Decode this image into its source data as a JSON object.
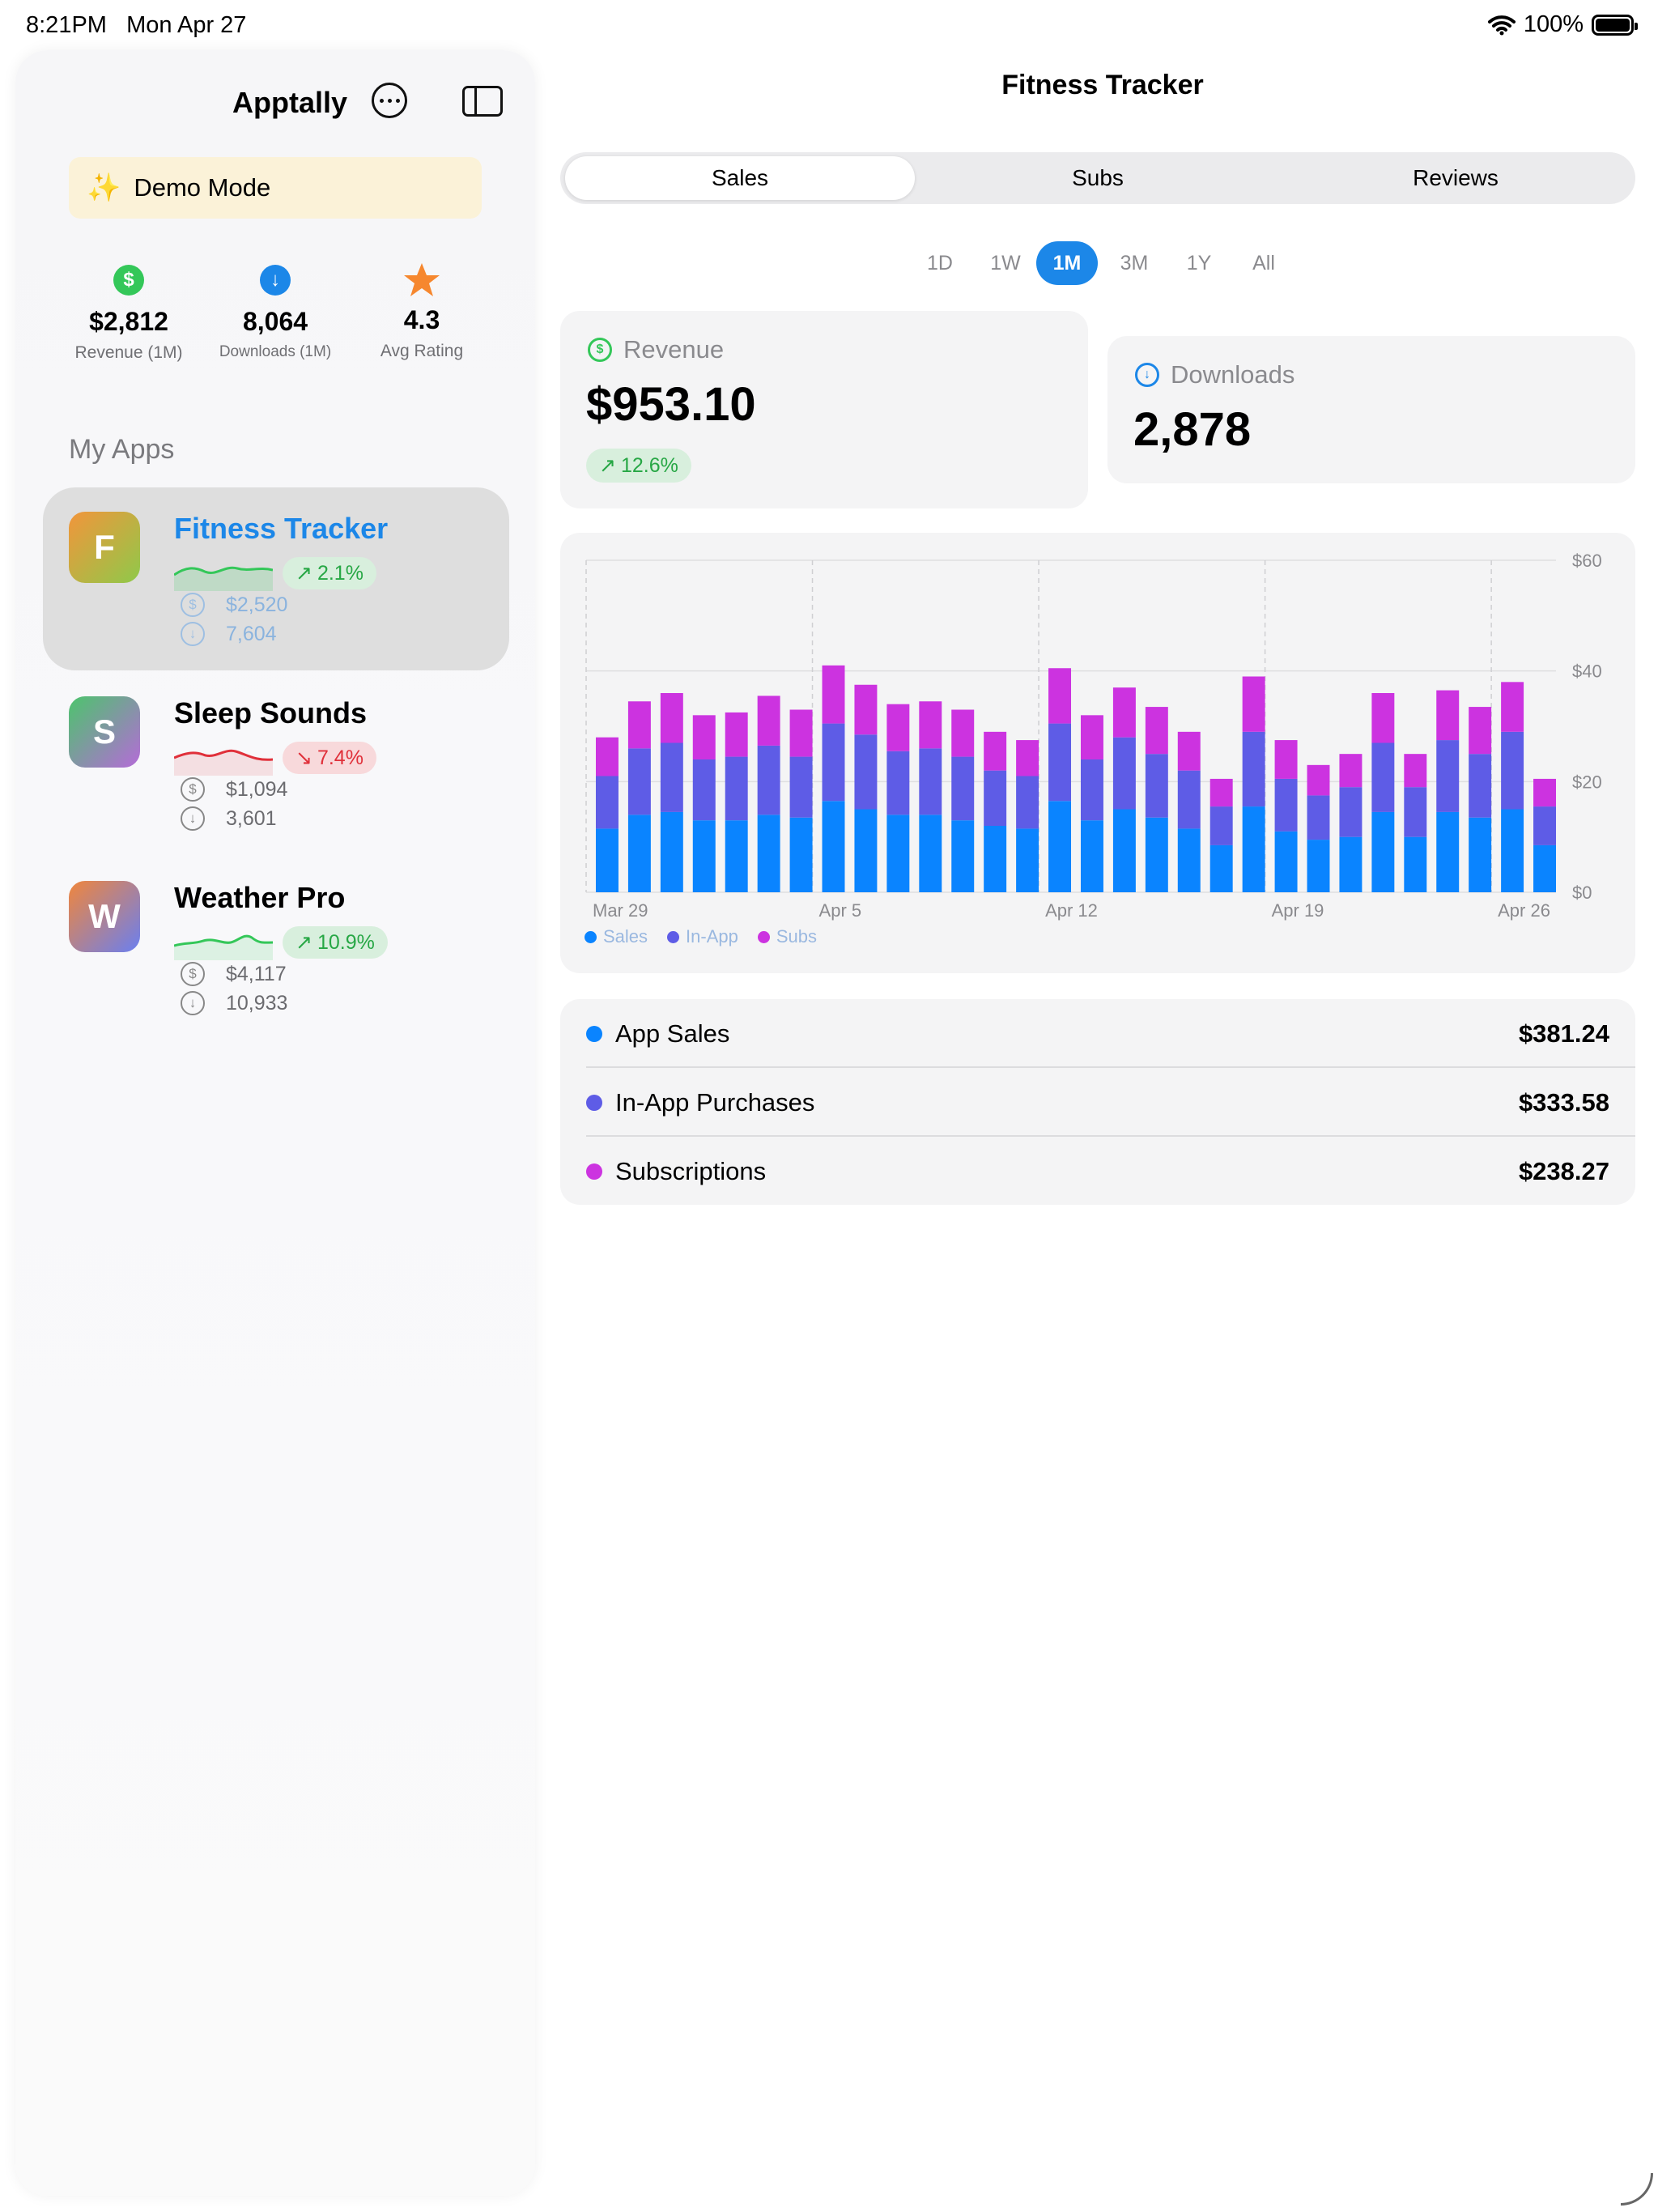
{
  "status_bar": {
    "time": "8:21PM",
    "date": "Mon Apr 27",
    "battery": "100%"
  },
  "sidebar": {
    "title": "Apptally",
    "demo_mode": "Demo Mode",
    "summary": [
      {
        "icon": "dollar-icon",
        "value": "$2,812",
        "label": "Revenue (1M)",
        "color": "#34c759"
      },
      {
        "icon": "download-icon",
        "value": "8,064",
        "label": "Downloads (1M)",
        "color": "#1c87e8"
      },
      {
        "icon": "star-icon",
        "value": "4.3",
        "label": "Avg Rating",
        "color": "#f6872e"
      }
    ],
    "section_title": "My Apps",
    "apps": [
      {
        "initial": "F",
        "name": "Fitness Tracker",
        "trend": "2.1%",
        "direction": "up",
        "revenue": "$2,520",
        "downloads": "7,604",
        "selected": true
      },
      {
        "initial": "S",
        "name": "Sleep Sounds",
        "trend": "7.4%",
        "direction": "down",
        "revenue": "$1,094",
        "downloads": "3,601",
        "selected": false
      },
      {
        "initial": "W",
        "name": "Weather Pro",
        "trend": "10.9%",
        "direction": "up",
        "revenue": "$4,117",
        "downloads": "10,933",
        "selected": false
      }
    ]
  },
  "main": {
    "title": "Fitness Tracker",
    "tabs": [
      "Sales",
      "Subs",
      "Reviews"
    ],
    "active_tab": "Sales",
    "ranges": [
      "1D",
      "1W",
      "1M",
      "3M",
      "1Y",
      "All"
    ],
    "active_range": "1M",
    "revenue": {
      "label": "Revenue",
      "value": "$953.10",
      "trend": "12.6%"
    },
    "downloads": {
      "label": "Downloads",
      "value": "2,878"
    },
    "breakdown": [
      {
        "label": "App Sales",
        "value": "$381.24",
        "color": "#0a84ff"
      },
      {
        "label": "In-App Purchases",
        "value": "$333.58",
        "color": "#5e5ce6"
      },
      {
        "label": "Subscriptions",
        "value": "$238.27",
        "color": "#cc33e0"
      }
    ]
  },
  "chart_data": {
    "type": "bar",
    "stacked": true,
    "x_tick_labels": [
      "Mar 29",
      "Apr 5",
      "Apr 12",
      "Apr 19",
      "Apr 26"
    ],
    "y_tick_labels": [
      "$0",
      "$20",
      "$40",
      "$60"
    ],
    "ylim": [
      0,
      60
    ],
    "series": [
      {
        "name": "Sales",
        "color": "#0a84ff",
        "values": [
          11.5,
          14,
          14.5,
          13,
          13,
          14,
          13.5,
          16.5,
          15,
          14,
          14,
          13,
          12,
          11.5,
          16.5,
          13,
          15,
          13.5,
          11.5,
          8.5,
          15.5,
          11,
          9.5,
          10,
          14.5,
          10,
          14.5,
          13.5,
          15,
          8.5
        ]
      },
      {
        "name": "In-App",
        "color": "#5e5ce6",
        "values": [
          9.5,
          12,
          12.5,
          11,
          11.5,
          12.5,
          11,
          14,
          13.5,
          11.5,
          12,
          11.5,
          10,
          9.5,
          14,
          11,
          13,
          11.5,
          10.5,
          7,
          13.5,
          9.5,
          8,
          9,
          12.5,
          9,
          13,
          11.5,
          14,
          7
        ]
      },
      {
        "name": "Subs",
        "color": "#cc33e0",
        "values": [
          7,
          8.5,
          9,
          8,
          8,
          9,
          8.5,
          10.5,
          9,
          8.5,
          8.5,
          8.5,
          7,
          6.5,
          10,
          8,
          9,
          8.5,
          7,
          5,
          10,
          7,
          5.5,
          6,
          9,
          6,
          9,
          8.5,
          9,
          5
        ]
      }
    ],
    "grid": true,
    "legend": "bottom-left"
  }
}
